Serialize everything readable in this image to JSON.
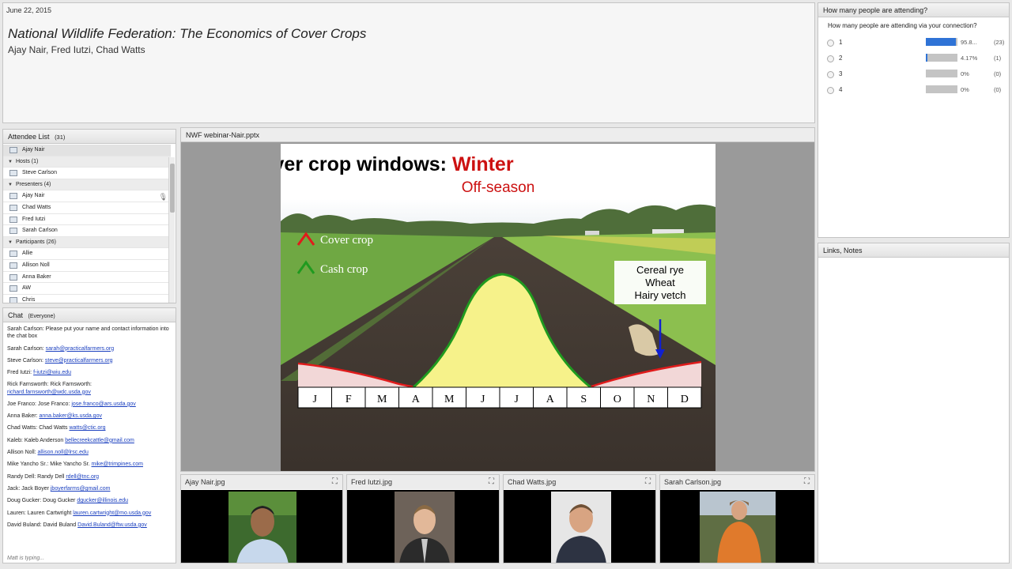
{
  "banner": {
    "date": "June 22, 2015",
    "title": "National Wildlife Federation: The Economics of Cover Crops",
    "subtitle": "Ajay Nair, Fred Iutzi, Chad Watts"
  },
  "poll": {
    "pod_title": "How many people are attending?",
    "question": "How many people are attending via your connection?",
    "options": [
      {
        "label": "1",
        "percent": "95.8...",
        "count": "(23)",
        "fraction": 0.958
      },
      {
        "label": "2",
        "percent": "4.17%",
        "count": "(1)",
        "fraction": 0.0417
      },
      {
        "label": "3",
        "percent": "0%",
        "count": "(0)",
        "fraction": 0
      },
      {
        "label": "4",
        "percent": "0%",
        "count": "(0)",
        "fraction": 0
      }
    ]
  },
  "links_pod": {
    "title": "Links, Notes"
  },
  "attendees": {
    "title": "Attendee List",
    "count": "(31)",
    "me": "Ajay Nair",
    "hosts_label": "Hosts (1)",
    "hosts": [
      "Steve Carlson"
    ],
    "presenters_label": "Presenters (4)",
    "presenters": [
      "Ajay Nair",
      "Chad Watts",
      "Fred Iutzi",
      "Sarah Carlson"
    ],
    "participants_label": "Participants (26)",
    "participants": [
      "Allie",
      "Allison Noll",
      "Anna Baker",
      "AW",
      "Chris"
    ]
  },
  "chat": {
    "title": "Chat",
    "scope": "(Everyone)",
    "typing": "Matt is typing...",
    "messages": [
      {
        "sender": "Sarah Carlson:",
        "text": "Please put your name and contact information into the chat box",
        "link": ""
      },
      {
        "sender": "Sarah Carlson:",
        "text": "",
        "link": "sarah@practicalfarmers.org"
      },
      {
        "sender": "Steve Carlson:",
        "text": "",
        "link": "steve@practicalfarmers.org"
      },
      {
        "sender": "Fred Iutzi:",
        "text": "",
        "link": "f-iutzi@wiu.edu"
      },
      {
        "sender": "Rick Farnsworth:",
        "text": "Rick Farnsworth:",
        "link": "richard.farnsworth@wdc.usda.gov"
      },
      {
        "sender": "Joe Franco:",
        "text": "Jose Franco:",
        "link": "jose.franco@ars.usda.gov"
      },
      {
        "sender": "Anna Baker:",
        "text": "",
        "link": "anna.baker@ks.usda.gov"
      },
      {
        "sender": "Chad Watts:",
        "text": "Chad Watts",
        "link": "watts@ctic.org"
      },
      {
        "sender": "Kaleb:",
        "text": "Kaleb Anderson",
        "link": "bellecreekcattle@gmail.com"
      },
      {
        "sender": "Allison Noll:",
        "text": "",
        "link": "allison.noll@lrsc.edu"
      },
      {
        "sender": "Mike Yancho Sr.:",
        "text": "Mike Yancho Sr.",
        "link": "mike@trimpines.com"
      },
      {
        "sender": "Randy Dell:",
        "text": "Randy Dell",
        "link": "rdell@tnc.org"
      },
      {
        "sender": "Jack:",
        "text": "Jack Boyer",
        "link": "jboyerfarms@gmail.com"
      },
      {
        "sender": "Doug Gucker:",
        "text": "Doug Gucker",
        "link": "dgucker@illinois.edu"
      },
      {
        "sender": "Lauren:",
        "text": "Lauren Cartwright",
        "link": "lauren.cartwright@mo.usda.gov"
      },
      {
        "sender": "David Buland:",
        "text": "David Buland",
        "link": "David.Buland@ftw.usda.gov"
      }
    ]
  },
  "share": {
    "title": "NWF webinar-Nair.pptx",
    "slide": {
      "heading": "Cover crop windows:",
      "heading_accent": "Winter",
      "subheading": "Off-season",
      "legend_cover": "Cover crop",
      "legend_cash": "Cash crop",
      "crops": [
        "Cereal rye",
        "Wheat",
        "Hairy vetch"
      ],
      "months": [
        "J",
        "F",
        "M",
        "A",
        "M",
        "J",
        "J",
        "A",
        "S",
        "O",
        "N",
        "D"
      ],
      "colors": {
        "cover": "#e01b1b",
        "cash": "#1f9a1f",
        "fill": "#f6f28a",
        "accent": "#cc1111"
      }
    }
  },
  "videos": [
    {
      "title": "Ajay Nair.jpg"
    },
    {
      "title": "Fred Iutzi.jpg"
    },
    {
      "title": "Chad Watts.jpg"
    },
    {
      "title": "Sarah Carlson.jpg"
    }
  ]
}
